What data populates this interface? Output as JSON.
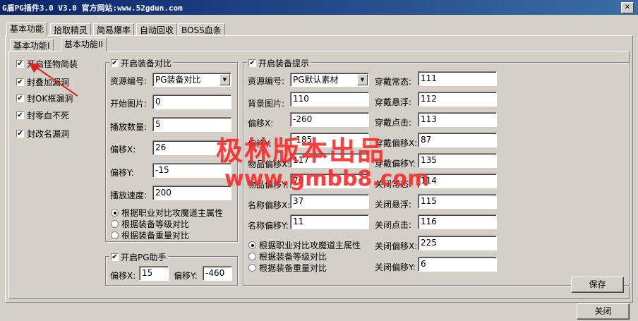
{
  "window": {
    "title": "G盾PG插件3.0 V3.0  官方网站:www.52gdun.com",
    "close_glyph": "✕"
  },
  "tabs": [
    "基本功能",
    "拾取精灵",
    "简易爆率",
    "自动回收",
    "BOSS血条"
  ],
  "subtabs": [
    "基本功能I",
    "基本功能II"
  ],
  "left_checks": [
    {
      "label": "开启怪物简装",
      "checked": true
    },
    {
      "label": "封叠加漏洞",
      "checked": true
    },
    {
      "label": "封OK框漏洞",
      "checked": true
    },
    {
      "label": "封零血不死",
      "checked": true
    },
    {
      "label": "封改名漏洞",
      "checked": true
    }
  ],
  "equip_compare": {
    "title": "开启装备对比",
    "checked": true,
    "resource_label": "资源编号:",
    "resource_value": "PG装备对比",
    "fields": [
      {
        "label": "开始图片:",
        "value": "0"
      },
      {
        "label": "播放数量:",
        "value": "5"
      },
      {
        "label": "偏移X:",
        "value": "26"
      },
      {
        "label": "偏移Y:",
        "value": "-15"
      },
      {
        "label": "播放速度:",
        "value": "200"
      }
    ],
    "radios": [
      {
        "label": "根据职业对比攻魔道主属性",
        "selected": true
      },
      {
        "label": "根据装备等级对比",
        "selected": false
      },
      {
        "label": "根据装备重量对比",
        "selected": false
      }
    ]
  },
  "pg_helper": {
    "title": "开启PG助手",
    "checked": true,
    "offset_x_label": "偏移X:",
    "offset_x": "15",
    "offset_y_label": "偏移Y:",
    "offset_y": "-460"
  },
  "equip_tip": {
    "title": "开启装备提示",
    "checked": true,
    "resource_label": "资源编号:",
    "resource_value": "PG默认素材",
    "left_fields": [
      {
        "label": "背景图片:",
        "value": "110"
      },
      {
        "label": "偏移X:",
        "value": "-260"
      },
      {
        "label": "偏移Y:",
        "value": "-185"
      },
      {
        "label": "物品偏移X:",
        "value": "117"
      },
      {
        "label": "物品偏移Y:",
        "value": "70"
      },
      {
        "label": "名称偏移X:",
        "value": "37"
      },
      {
        "label": "名称偏移Y:",
        "value": "11"
      }
    ],
    "right_fields": [
      {
        "label": "穿戴常态:",
        "value": "111"
      },
      {
        "label": "穿戴悬浮:",
        "value": "112"
      },
      {
        "label": "穿戴点击:",
        "value": "113"
      },
      {
        "label": "穿戴偏移X:",
        "value": "87"
      },
      {
        "label": "穿戴偏移Y:",
        "value": "135"
      },
      {
        "label": "关闭常态:",
        "value": "114"
      },
      {
        "label": "关闭悬浮:",
        "value": "115"
      },
      {
        "label": "关闭点击:",
        "value": "116"
      },
      {
        "label": "关闭偏移X:",
        "value": "225"
      },
      {
        "label": "关闭偏移Y:",
        "value": "6"
      }
    ],
    "radios": [
      {
        "label": "根据职业对比攻魔道主属性",
        "selected": true
      },
      {
        "label": "根据装备等级对比",
        "selected": false
      },
      {
        "label": "根据装备重量对比",
        "selected": false
      }
    ]
  },
  "buttons": {
    "save": "保存",
    "close": "关闭"
  },
  "watermark": {
    "line1": "极林版本出品",
    "line2": "www.gmbb8.com"
  },
  "colors": {
    "face": "#d4d0c8",
    "titlebar": "#0a246a",
    "watermark": "#ff2a2a",
    "arrow": "#e02020"
  }
}
